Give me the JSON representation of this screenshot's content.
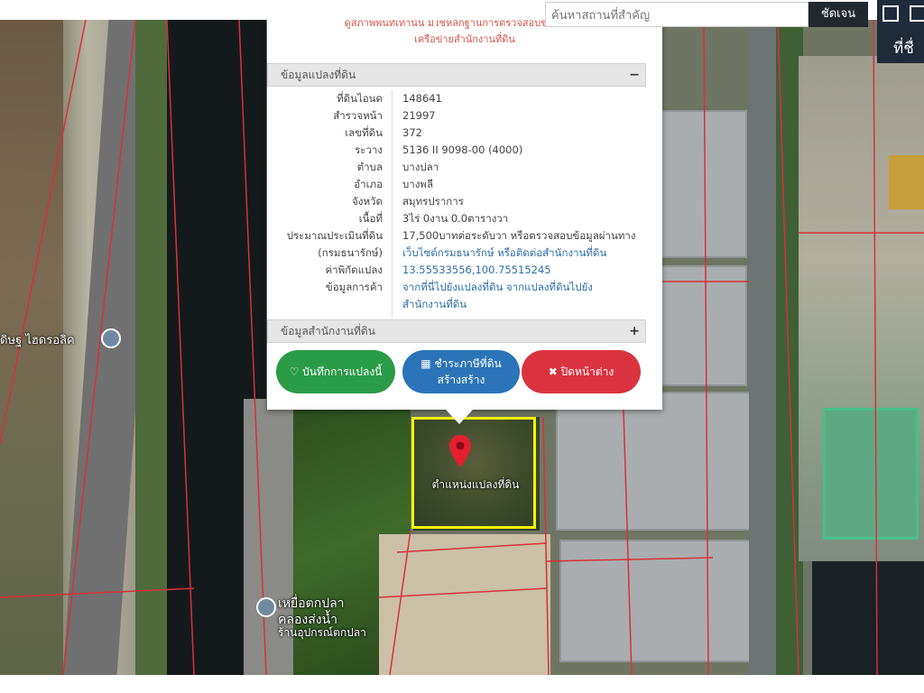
{
  "popup": {
    "warning_line1": "ดูสภาพพื้นที่เท่านั้น มิใช่หลักฐานการตรวจสอบข้อเท็จจริง",
    "warning_line2": "เครือข่ายสำนักงานที่ดิน",
    "section1_title": "ข้อมูลแปลงที่ดิน",
    "section1_toggle": "−",
    "section2_title": "ข้อมูลสำนักงานที่ดิน",
    "section2_toggle": "+",
    "rows": [
      {
        "key": "ที่ดินไอนด",
        "value": "148641"
      },
      {
        "key": "สำรวจหน้า",
        "value": "21997"
      },
      {
        "key": "เลขที่ดิน",
        "value": "372"
      },
      {
        "key": "ระวาง",
        "value": "5136 II 9098-00 (4000)"
      },
      {
        "key": "ตำบล",
        "value": "บางปลา"
      },
      {
        "key": "อำเภอ",
        "value": "บางพลี"
      },
      {
        "key": "จังหวัด",
        "value": "สมุทรปราการ"
      },
      {
        "key": "เนื้อที่",
        "value": "3ไร่ 0งาน 0.0ตารางวา"
      },
      {
        "key": "ประมาณประเมินที่ดิน",
        "value": "17,500บาทต่อระดับวา หรือตรวจสอบข้อมูลผ่านทาง"
      },
      {
        "key": "(กรมธนารักษ์)",
        "value": "เว็บไซต์กรมธนารักษ์ หรือติดต่อสำนักงานที่ดิน"
      },
      {
        "key": "ค่าพิกัดแปลง",
        "value": "13.55533556,100.75515245"
      },
      {
        "key": "ข้อมูลการค้า",
        "value": "จากที่นี่ไปยังแปลงที่ดิน จากแปลงที่ดินไปยัง"
      },
      {
        "key": "",
        "value": "สำนักงานที่ดิน"
      }
    ],
    "btn_save": "บันทึกการแปลงนี้",
    "btn_pay_l1": "ชำระภาษีที่ดิน",
    "btn_pay_l2": "สร้างสร้าง",
    "btn_close": "ปิดหน้าต่าง"
  },
  "search": {
    "placeholder": "ค้นหาสถานที่สำคัญ",
    "button": "ชัดเจน"
  },
  "controls": {
    "label": "ที่ชื่"
  },
  "map": {
    "parcel_label": "ตำแหน่งแปลงที่ดิน",
    "poi1": "ดิษฐ ไฮดรอลิค",
    "poi2_l1": "เหยื่อตกปลา",
    "poi2_l2": "คลองส่งน้ำ",
    "poi2_l3": "ร้านอุปกรณ์ตกปลา"
  },
  "colors": {
    "parcel_border": "#f5f200",
    "boundary_lines": "#d8303a",
    "save_button": "#2a9b46",
    "pay_button": "#2b74b8",
    "close_button": "#d9333f"
  }
}
